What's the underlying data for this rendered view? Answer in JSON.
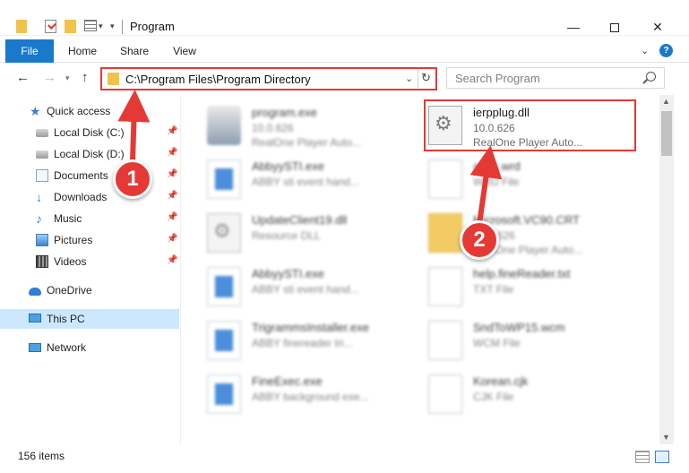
{
  "window": {
    "title": "Program",
    "min_glyph": "—",
    "close_glyph": "✕"
  },
  "ribbon": {
    "tabs": [
      "File",
      "Home",
      "Share",
      "View"
    ],
    "help_glyph": "?"
  },
  "nav": {
    "address": "C:\\Program Files\\Program Directory",
    "search_placeholder": "Search Program"
  },
  "sidebar": {
    "items": [
      {
        "label": "Quick access",
        "icon": "star-icon",
        "pinned": false
      },
      {
        "label": "Local Disk (C:)",
        "icon": "drive-icon",
        "pinned": true
      },
      {
        "label": "Local Disk (D:)",
        "icon": "drive-icon",
        "pinned": true
      },
      {
        "label": "Documents",
        "icon": "documents-icon",
        "pinned": true
      },
      {
        "label": "Downloads",
        "icon": "download-icon",
        "pinned": true
      },
      {
        "label": "Music",
        "icon": "music-icon",
        "pinned": true
      },
      {
        "label": "Pictures",
        "icon": "pictures-icon",
        "pinned": true
      },
      {
        "label": "Videos",
        "icon": "videos-icon",
        "pinned": true
      },
      {
        "label": "OneDrive",
        "icon": "onedrive-icon",
        "pinned": false
      },
      {
        "label": "This PC",
        "icon": "this-pc-icon",
        "pinned": false,
        "selected": true
      },
      {
        "label": "Network",
        "icon": "network-icon",
        "pinned": false
      }
    ]
  },
  "files": [
    {
      "name": "program.exe",
      "l2": "10.0.626",
      "l3": "RealOne Player Auto...",
      "icon": "program-icon",
      "blurred": true
    },
    {
      "name": "ierpplug.dll",
      "l2": "10.0.626",
      "l3": "RealOne Player Auto...",
      "icon": "dll-icon",
      "blurred": false
    },
    {
      "name": "AbbyySTI.exe",
      "l2": "ABBY sti event hand...",
      "l3": "",
      "icon": "exe-icon",
      "blurred": true
    },
    {
      "name": "abbc.wrd",
      "l2": "WRD File",
      "l3": "",
      "icon": "file-icon",
      "blurred": true
    },
    {
      "name": "UpdateClient19.dll",
      "l2": "Resource DLL",
      "l3": "",
      "icon": "dll-icon",
      "blurred": true
    },
    {
      "name": "Microsoft.VC90.CRT",
      "l2": "10.0.626",
      "l3": "RealOne Player Auto...",
      "icon": "folder-icon",
      "blurred": true
    },
    {
      "name": "AbbyySTI.exe",
      "l2": "ABBY sti event hand...",
      "l3": "",
      "icon": "exe-icon",
      "blurred": true
    },
    {
      "name": "help.fineReader.txt",
      "l2": "TXT File",
      "l3": "",
      "icon": "file-icon",
      "blurred": true
    },
    {
      "name": "TrigrammsInstaller.exe",
      "l2": "ABBY finereader tri...",
      "l3": "",
      "icon": "exe-icon",
      "blurred": true
    },
    {
      "name": "SndToWP15.wcm",
      "l2": "WCM File",
      "l3": "",
      "icon": "file-icon",
      "blurred": true
    },
    {
      "name": "FineExec.exe",
      "l2": "ABBY background exe...",
      "l3": "",
      "icon": "exe-icon",
      "blurred": true
    },
    {
      "name": "Korean.cjk",
      "l2": "CJK File",
      "l3": "",
      "icon": "file-icon",
      "blurred": true
    }
  ],
  "status": {
    "item_count": "156 items"
  },
  "markers": [
    "1",
    "2"
  ],
  "colors": {
    "accent": "#1979ca",
    "highlight": "#e53935",
    "selected": "#cce8ff"
  }
}
